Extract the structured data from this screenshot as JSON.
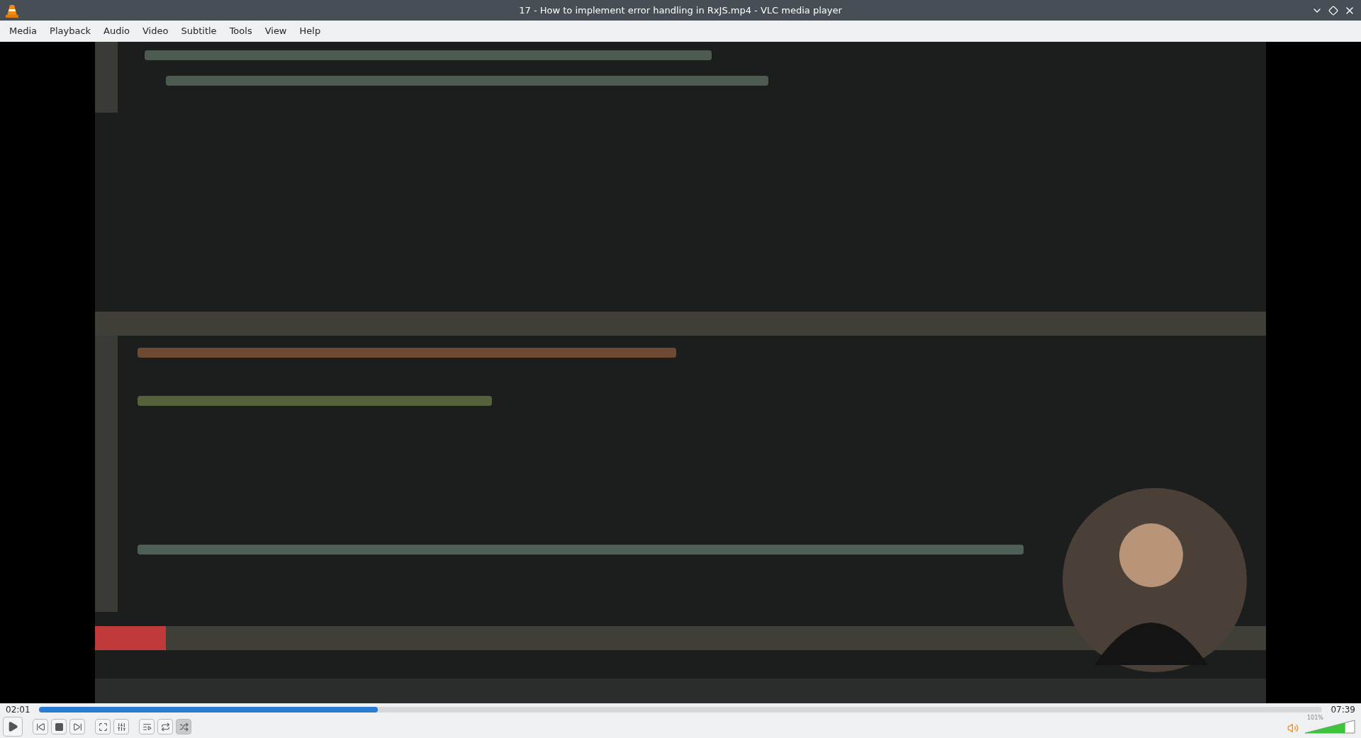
{
  "window": {
    "title": "17 - How to implement error handling in RxJS.mp4 - VLC media player"
  },
  "menu": [
    "Media",
    "Playback",
    "Audio",
    "Video",
    "Subtitle",
    "Tools",
    "View",
    "Help"
  ],
  "video": {
    "kind": "picture"
  },
  "seek": {
    "elapsed": "02:01",
    "total": "07:39",
    "level": 0.264
  },
  "controls": [
    {
      "kind": "play",
      "selected": false
    },
    {
      "kind": "prev",
      "selected": false
    },
    {
      "kind": "stop",
      "selected": false
    },
    {
      "kind": "next",
      "selected": false
    },
    {
      "kind": "fullscreen",
      "selected": false
    },
    {
      "kind": "settings",
      "selected": false
    },
    {
      "kind": "playlist",
      "selected": false
    },
    {
      "kind": "loop",
      "selected": false
    },
    {
      "kind": "shuffle",
      "selected": true
    }
  ],
  "volume": {
    "reading": "101%",
    "level": 0.81
  }
}
